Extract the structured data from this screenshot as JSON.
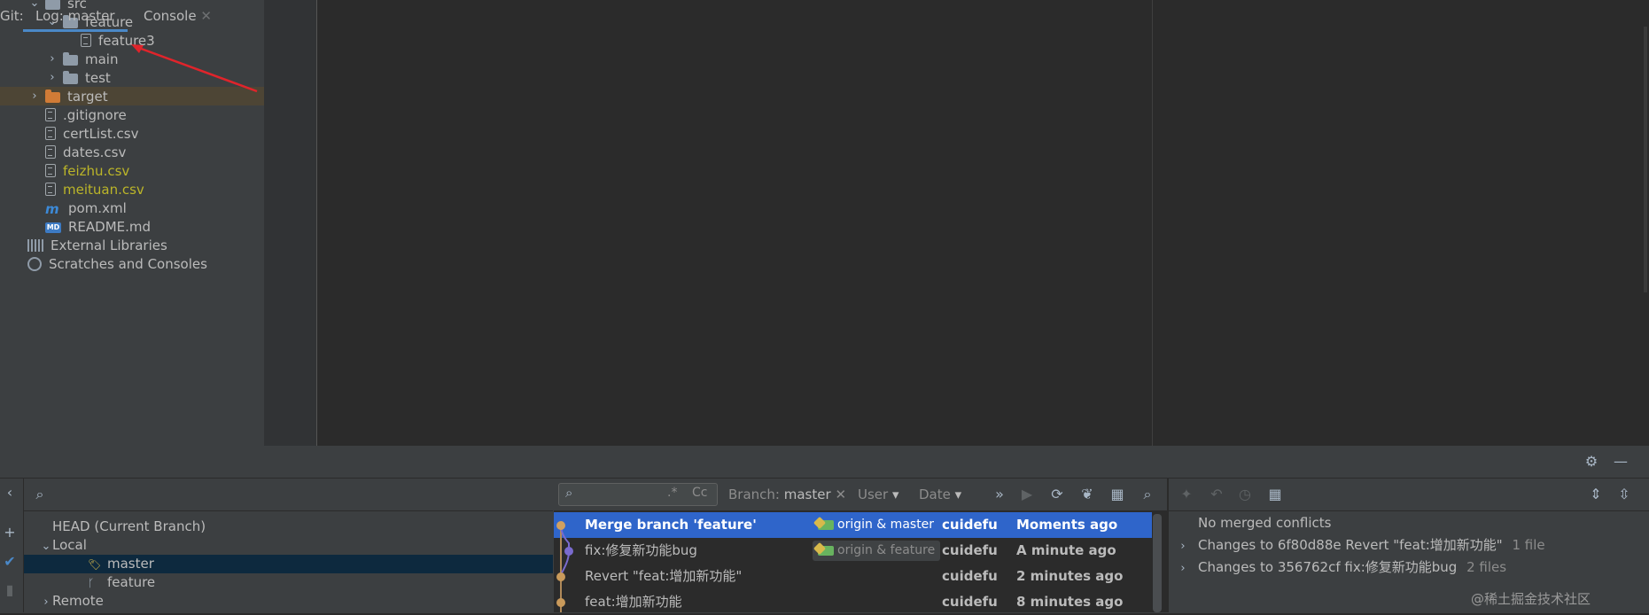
{
  "project_tree": [
    {
      "label": "src",
      "indent": 1,
      "chevron": "open",
      "icon": "folder"
    },
    {
      "label": "feature",
      "indent": 2,
      "chevron": "open",
      "icon": "folder"
    },
    {
      "label": "feature3",
      "indent": 3,
      "chevron": "",
      "icon": "file"
    },
    {
      "label": "main",
      "indent": 2,
      "chevron": "closed",
      "icon": "folder"
    },
    {
      "label": "test",
      "indent": 2,
      "chevron": "closed",
      "icon": "folder"
    },
    {
      "label": "target",
      "indent": 1,
      "chevron": "closed",
      "icon": "folder-orange",
      "highlight": true
    },
    {
      "label": ".gitignore",
      "indent": 1,
      "chevron": "",
      "icon": "file"
    },
    {
      "label": "certList.csv",
      "indent": 1,
      "chevron": "",
      "icon": "file"
    },
    {
      "label": "dates.csv",
      "indent": 1,
      "chevron": "",
      "icon": "file"
    },
    {
      "label": "feizhu.csv",
      "indent": 1,
      "chevron": "",
      "icon": "file",
      "color": "yellow"
    },
    {
      "label": "meituan.csv",
      "indent": 1,
      "chevron": "",
      "icon": "file",
      "color": "yellow"
    },
    {
      "label": "pom.xml",
      "indent": 1,
      "chevron": "",
      "icon": "maven"
    },
    {
      "label": "README.md",
      "indent": 1,
      "chevron": "",
      "icon": "markdown"
    },
    {
      "label": "External Libraries",
      "indent": 0,
      "chevron": "",
      "icon": "libraries"
    },
    {
      "label": "Scratches and Consoles",
      "indent": 0,
      "chevron": "",
      "icon": "scratch"
    }
  ],
  "icons": {
    "md_badge": "MD",
    "maven_mark": "m"
  },
  "git": {
    "prefix": "Git:",
    "tabs": [
      {
        "label": "Log: master",
        "active": true
      },
      {
        "label": "Console",
        "closable": true
      }
    ],
    "branches": [
      {
        "label": "HEAD (Current Branch)",
        "indent": 0,
        "chevron": ""
      },
      {
        "label": "Local",
        "indent": 0,
        "chevron": "open"
      },
      {
        "label": "master",
        "indent": 2,
        "chevron": "",
        "icon": "tag",
        "selected": true
      },
      {
        "label": "feature",
        "indent": 2,
        "chevron": "",
        "icon": "branch"
      },
      {
        "label": "Remote",
        "indent": 0,
        "chevron": "closed"
      }
    ],
    "log_toolbar": {
      "search_regex": ".*",
      "search_case": "Cc",
      "branch_label": "Branch:",
      "branch_value": "master",
      "user_label": "User",
      "date_label": "Date"
    },
    "commits": [
      {
        "message": "Merge branch 'feature'",
        "tag": "origin & master",
        "author": "cuidefu",
        "date": "Moments ago",
        "selected": true
      },
      {
        "message": "fix:修复新功能bug",
        "tag": "origin & feature",
        "author": "cuidefu",
        "date": "A minute ago"
      },
      {
        "message": "Revert \"feat:增加新功能\"",
        "tag": "",
        "author": "cuidefu",
        "date": "2 minutes ago"
      },
      {
        "message": "feat:增加新功能",
        "tag": "",
        "author": "cuidefu",
        "date": "8 minutes ago"
      }
    ],
    "details": [
      {
        "chevron": "",
        "text": "No merged conflicts",
        "suffix": ""
      },
      {
        "chevron": "closed",
        "text": "Changes to 6f80d88e Revert \"feat:增加新功能\"",
        "suffix": "1 file"
      },
      {
        "chevron": "closed",
        "text": "Changes to 356762cf fix:修复新功能bug",
        "suffix": "2 files"
      }
    ]
  },
  "watermark": "@稀土掘金技术社区",
  "colors": {
    "selection": "#2f65ca",
    "tree_bg": "#3c3f41",
    "editor_bg": "#2b2b2b",
    "yellow_file": "#bbb529",
    "arrow": "#e0242b"
  }
}
